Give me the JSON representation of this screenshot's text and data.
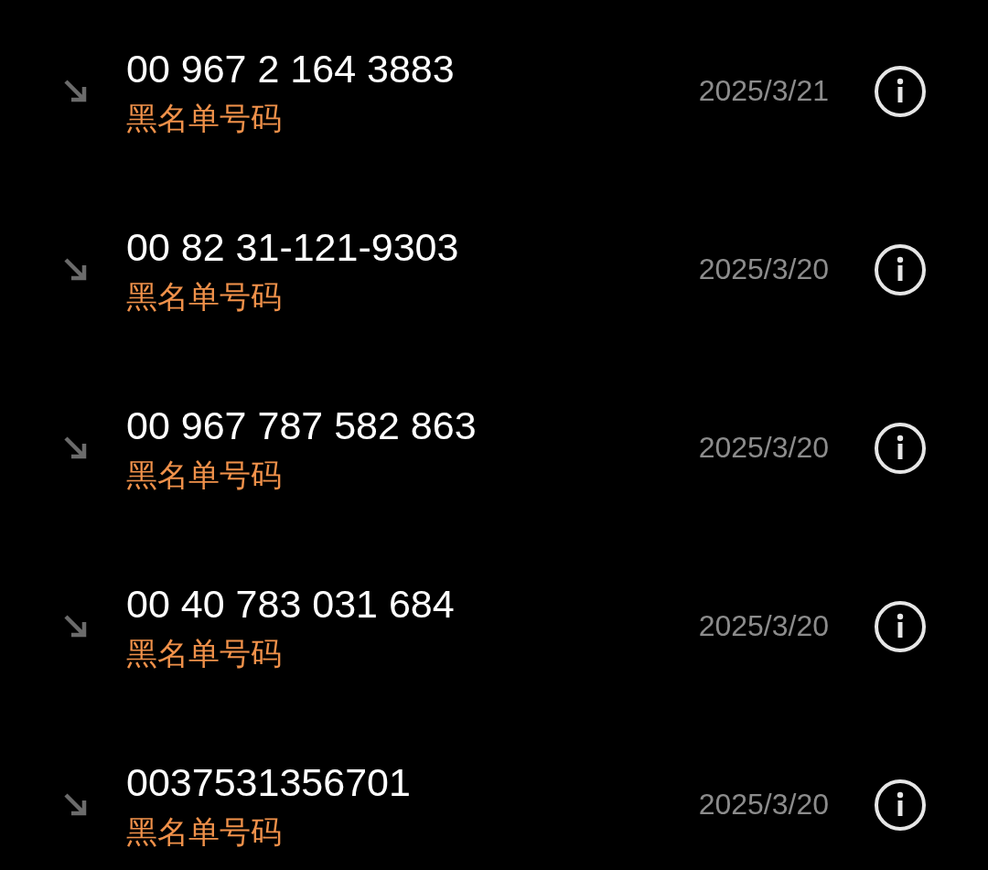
{
  "calls": [
    {
      "number": "00 967 2 164 3883",
      "label": "黑名单号码",
      "date": "2025/3/21"
    },
    {
      "number": "00 82 31-121-9303",
      "label": "黑名单号码",
      "date": "2025/3/20"
    },
    {
      "number": "00 967 787 582 863",
      "label": "黑名单号码",
      "date": "2025/3/20"
    },
    {
      "number": "00 40 783 031 684",
      "label": "黑名单号码",
      "date": "2025/3/20"
    },
    {
      "number": "0037531356701",
      "label": "黑名单号码",
      "date": "2025/3/20"
    }
  ]
}
